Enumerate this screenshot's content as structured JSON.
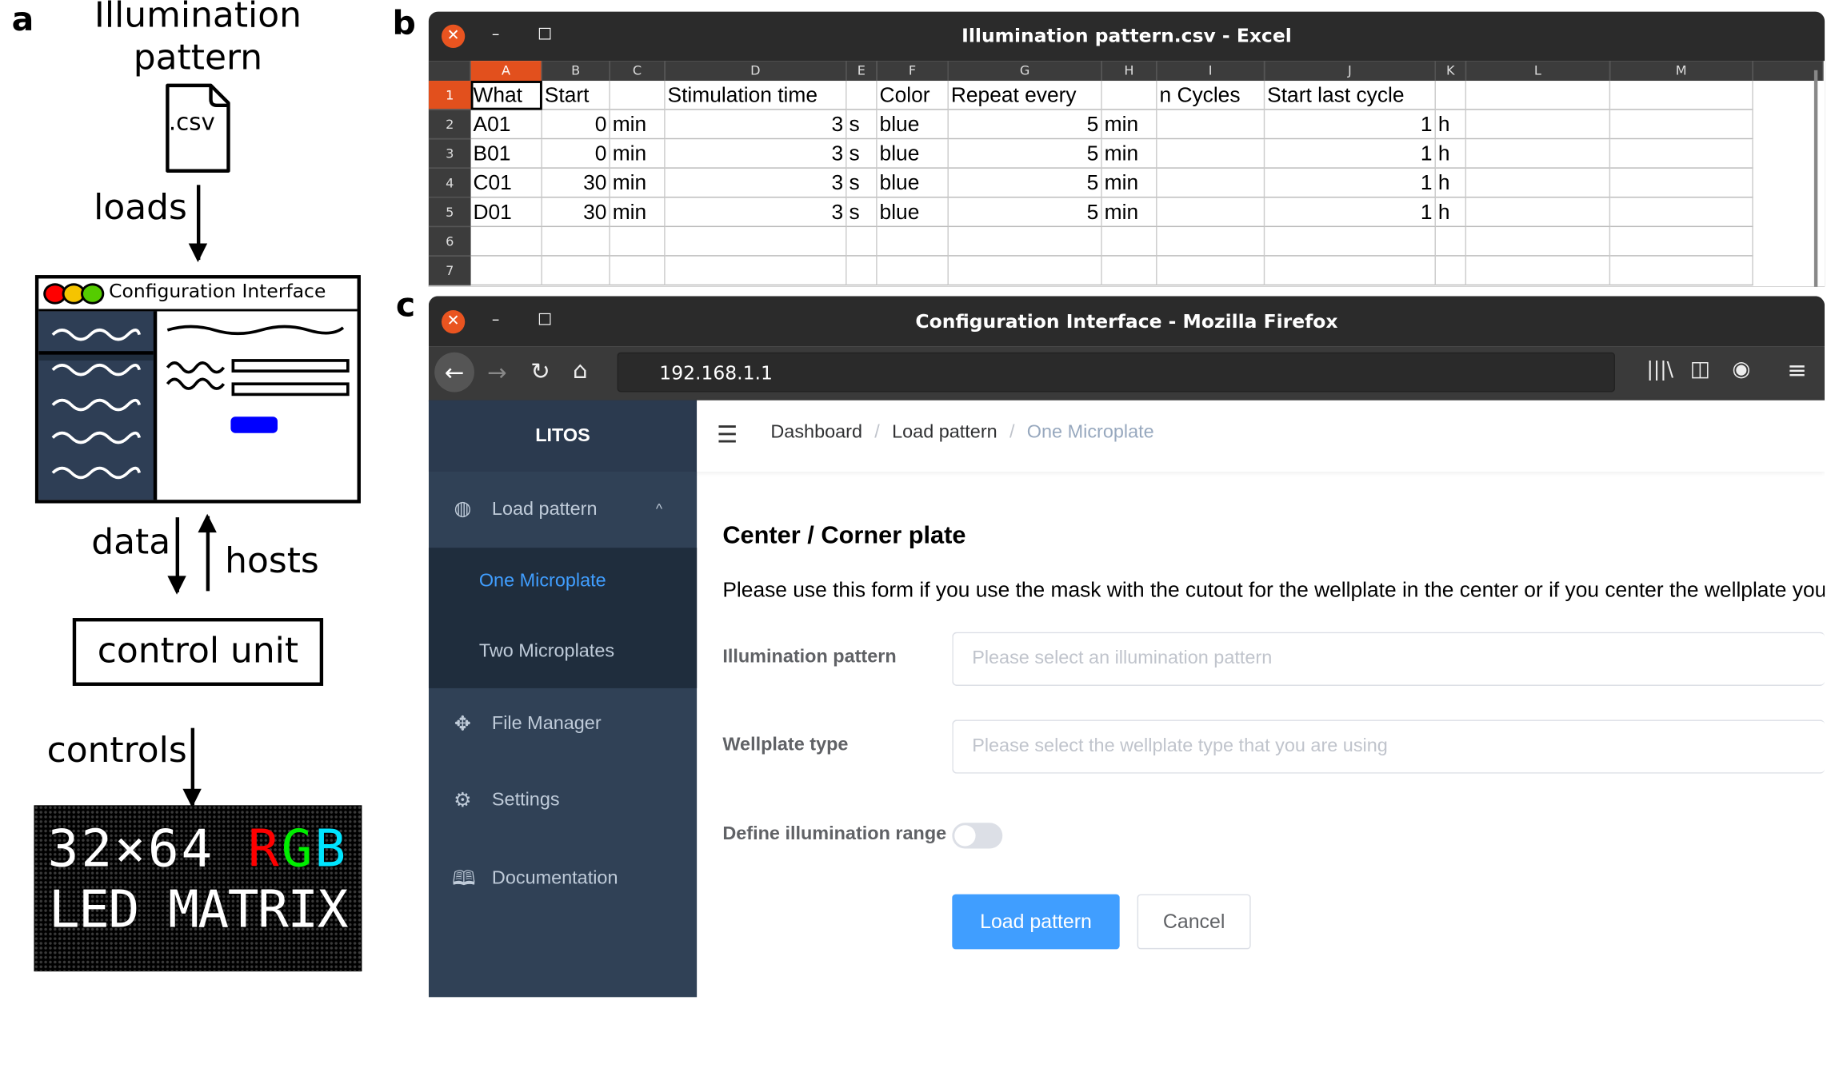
{
  "panel_a": {
    "label": "a",
    "file_title": "Illumination pattern",
    "file_ext": ".csv",
    "loads": "loads",
    "config_title": "Configuration Interface",
    "data": "data",
    "hosts": "hosts",
    "control_unit": "control unit",
    "controls": "controls",
    "led_line1_white": "32×64",
    "led_line1_rgb": [
      "R",
      "G",
      "B"
    ],
    "led_line2": "LED MATRIX",
    "colors": {
      "sidebar": "#2e3e55",
      "button": "#0000ff",
      "red": "#ff0000",
      "yellow": "#f5c400",
      "green": "#55cc00",
      "led_r": "#ff0000",
      "led_g": "#00ee00",
      "led_b": "#00e5ff"
    }
  },
  "panel_b": {
    "label": "b",
    "window_title": "Illumination pattern.csv - Excel",
    "columns": [
      "A",
      "B",
      "C",
      "D",
      "E",
      "F",
      "G",
      "H",
      "I",
      "J",
      "K",
      "L",
      "M"
    ],
    "rows": [
      [
        "What",
        "Start",
        "",
        "Stimulation time",
        "",
        "Color",
        "Repeat every",
        "",
        "n Cycles",
        "Start last cycle",
        "",
        "",
        ""
      ],
      [
        "A01",
        "0",
        "min",
        "3",
        "s",
        "blue",
        "5",
        "min",
        "",
        "1",
        "h",
        "",
        ""
      ],
      [
        "B01",
        "0",
        "min",
        "3",
        "s",
        "blue",
        "5",
        "min",
        "",
        "1",
        "h",
        "",
        ""
      ],
      [
        "C01",
        "30",
        "min",
        "3",
        "s",
        "blue",
        "5",
        "min",
        "",
        "1",
        "h",
        "",
        ""
      ],
      [
        "D01",
        "30",
        "min",
        "3",
        "s",
        "blue",
        "5",
        "min",
        "",
        "1",
        "h",
        "",
        ""
      ],
      [
        "",
        "",
        "",
        "",
        "",
        "",
        "",
        "",
        "",
        "",
        "",
        "",
        ""
      ],
      [
        "",
        "",
        "",
        "",
        "",
        "",
        "",
        "",
        "",
        "",
        "",
        "",
        ""
      ]
    ],
    "row_numbers": [
      "1",
      "2",
      "3",
      "4",
      "5",
      "6",
      "7"
    ],
    "accent": "#e2501d"
  },
  "panel_c": {
    "label": "c",
    "window_title": "Configuration Interface - Mozilla Firefox",
    "url": "192.168.1.1",
    "brand": "LITOS",
    "sidebar": {
      "load_pattern": "Load pattern",
      "one_microplate": "One Microplate",
      "two_microplates": "Two Microplates",
      "file_manager": "File Manager",
      "settings": "Settings",
      "documentation": "Documentation"
    },
    "breadcrumb": [
      "Dashboard",
      "Load pattern",
      "One Microplate"
    ],
    "heading": "Center / Corner plate",
    "description": "Please use this form if you use the mask with the cutout for the wellplate in the center or if you center the wellplate yourself",
    "form": {
      "pattern_label": "Illumination pattern",
      "pattern_placeholder": "Please select an illumination pattern",
      "wellplate_label": "Wellplate type",
      "wellplate_placeholder": "Please select the wellplate type that you are using",
      "range_label": "Define illumination range",
      "range_enabled": false,
      "submit": "Load pattern",
      "cancel": "Cancel"
    },
    "colors": {
      "sidebar": "#304156",
      "submenu": "#1f2d3d",
      "active": "#409eff",
      "primary": "#409eff"
    }
  }
}
